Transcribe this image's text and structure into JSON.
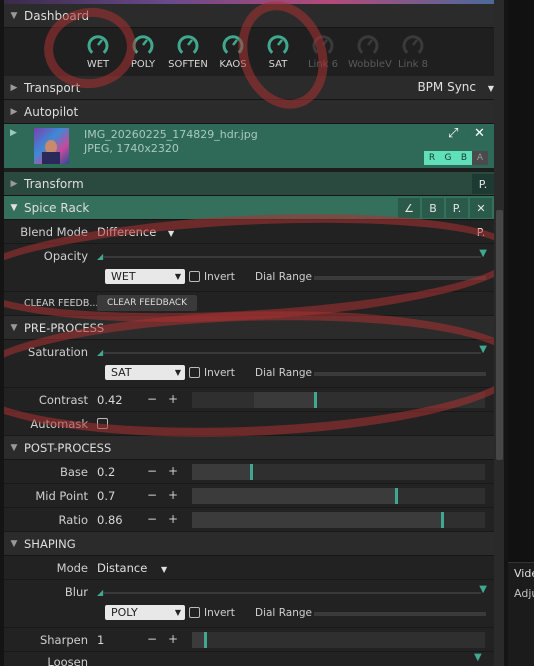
{
  "dashboard": {
    "title": "Dashboard",
    "dials": [
      {
        "label": "WET",
        "enabled": true
      },
      {
        "label": "POLY",
        "enabled": true
      },
      {
        "label": "SOFTEN",
        "enabled": true
      },
      {
        "label": "KAOS",
        "enabled": true
      },
      {
        "label": "SAT",
        "enabled": true
      },
      {
        "label": "Link 6",
        "enabled": false
      },
      {
        "label": "WobbleV",
        "enabled": false
      },
      {
        "label": "Link 8",
        "enabled": false
      }
    ]
  },
  "transport": {
    "title": "Transport",
    "bpm_sync": "BPM Sync"
  },
  "autopilot": {
    "title": "Autopilot"
  },
  "source": {
    "filename": "IMG_20260225_174829_hdr.jpg",
    "info": "JPEG, 1740x2320",
    "channels": [
      "R",
      "G",
      "B",
      "A"
    ]
  },
  "transform": {
    "title": "Transform",
    "p_label": "P."
  },
  "spice_rack": {
    "title": "Spice Rack",
    "toolbar": [
      "∠",
      "B",
      "P.",
      "✕"
    ],
    "blend_mode_label": "Blend Mode",
    "blend_mode_value": "Difference",
    "blend_p": "P.",
    "opacity": {
      "label": "Opacity",
      "value": 1.0,
      "mod_source": "WET",
      "invert_label": "Invert",
      "dial_range_label": "Dial Range"
    },
    "clear_feedback": {
      "label": "CLEAR FEEDB...",
      "button": "CLEAR FEEDBACK"
    }
  },
  "pre_process": {
    "title": "PRE-PROCESS",
    "saturation": {
      "label": "Saturation",
      "value": 1.0,
      "mod_source": "SAT",
      "invert_label": "Invert",
      "dial_range_label": "Dial Range"
    },
    "contrast": {
      "label": "Contrast",
      "value": "0.42",
      "fraction": 0.42
    },
    "automask": {
      "label": "Automask"
    }
  },
  "post_process": {
    "title": "POST-PROCESS",
    "base": {
      "label": "Base",
      "value": "0.2",
      "fraction": 0.2
    },
    "mid_point": {
      "label": "Mid Point",
      "value": "0.7",
      "fraction": 0.7
    },
    "ratio": {
      "label": "Ratio",
      "value": "0.86",
      "fraction": 0.86
    }
  },
  "shaping": {
    "title": "SHAPING",
    "mode_label": "Mode",
    "mode_value": "Distance",
    "blur": {
      "label": "Blur",
      "value": 1.0,
      "mod_source": "POLY",
      "invert_label": "Invert",
      "dial_range_label": "Dial Range"
    },
    "sharpen": {
      "label": "Sharpen",
      "value": "1",
      "fraction": 0.04
    },
    "loosen": {
      "label": "Loosen"
    }
  },
  "side_panel": {
    "item1": "Vide",
    "item2": "Adju"
  },
  "colors": {
    "accent": "#3fa88e",
    "selected": "#3a7a66",
    "annotation": "#a83232"
  }
}
